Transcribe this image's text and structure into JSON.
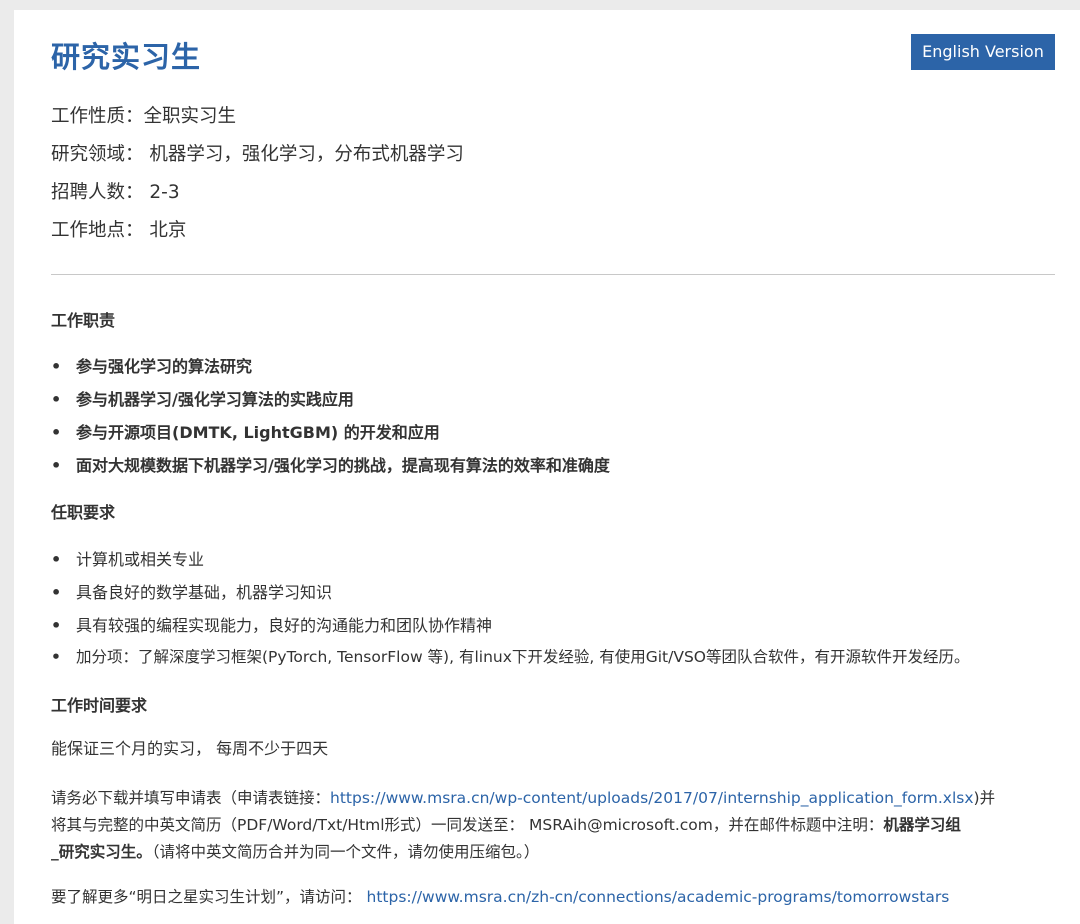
{
  "header": {
    "title": "研究实习生",
    "english_button": "English Version"
  },
  "meta": {
    "job_type": "工作性质：全职实习生",
    "research_field": "研究领域： 机器学习，强化学习，分布式机器学习",
    "headcount": "招聘人数： 2-3",
    "location": "工作地点： 北京"
  },
  "responsibilities": {
    "heading": "工作职责",
    "items": [
      "参与强化学习的算法研究",
      "参与机器学习/强化学习算法的实践应用",
      "参与开源项目(DMTK, LightGBM) 的开发和应用",
      "面对大规模数据下机器学习/强化学习的挑战，提高现有算法的效率和准确度"
    ]
  },
  "requirements": {
    "heading": "任职要求",
    "items": [
      "计算机或相关专业",
      "具备良好的数学基础，机器学习知识",
      "具有较强的编程实现能力，良好的沟通能力和团队协作精神",
      "加分项：了解深度学习框架(PyTorch, TensorFlow 等), 有linux下开发经验, 有使用Git/VSO等团队合软件，有开源软件开发经历。"
    ]
  },
  "schedule": {
    "heading": "工作时间要求",
    "text": "能保证三个月的实习， 每周不少于四天"
  },
  "apply": {
    "line1_prefix": "请务必下载并填写申请表（申请表链接：",
    "form_link": "https://www.msra.cn/wp-content/uploads/2017/07/internship_application_form.xlsx",
    "line1_suffix": ")并",
    "line2_prefix": "将其与完整的中英文简历（PDF/Word/Txt/Html形式）一同发送至： MSRAih@microsoft.com，并在邮件标题中注明：",
    "line2_bold": "机器学习组",
    "line3_bold": "_研究实习生。",
    "line3_suffix": "（请将中英文简历合并为同一个文件，请勿使用压缩包。）"
  },
  "more_info": {
    "prefix": "要了解更多“明日之星实习生计划”，请访问： ",
    "link": "https://www.msra.cn/zh-cn/connections/academic-programs/tomorrowstars"
  }
}
